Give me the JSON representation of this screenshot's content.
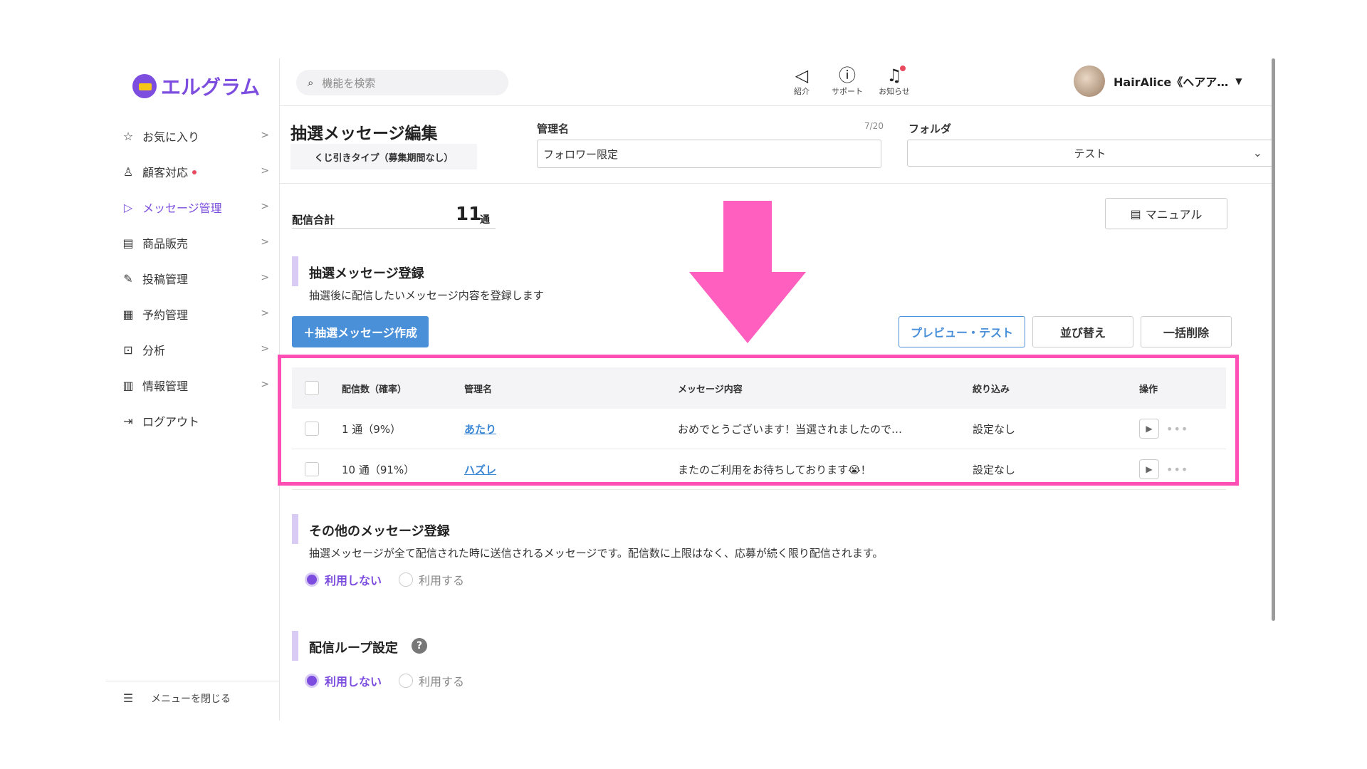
{
  "app": {
    "name": "エルグラム"
  },
  "sidebar": {
    "items": [
      {
        "label": "お気に入り",
        "icon": "star-icon",
        "glyph": "☆"
      },
      {
        "label": "顧客対応",
        "icon": "person-icon",
        "glyph": "♙"
      },
      {
        "label": "メッセージ管理",
        "icon": "send-icon",
        "glyph": "▷"
      },
      {
        "label": "商品販売",
        "icon": "store-icon",
        "glyph": "▤"
      },
      {
        "label": "投稿管理",
        "icon": "edit-icon",
        "glyph": "✎"
      },
      {
        "label": "予約管理",
        "icon": "calendar-icon",
        "glyph": "▦"
      },
      {
        "label": "分析",
        "icon": "analysis-icon",
        "glyph": "⊡"
      },
      {
        "label": "情報管理",
        "icon": "chart-icon",
        "glyph": "▥"
      },
      {
        "label": "ログアウト",
        "icon": "logout-icon",
        "glyph": "⇥"
      }
    ],
    "close_menu": "メニューを閉じる",
    "accent": "#7c4dde"
  },
  "header": {
    "search_placeholder": "機能を検索",
    "intro": "紹介",
    "support": "サポート",
    "notifications": "お知らせ",
    "user_name": "HairAlice《ヘアア…"
  },
  "page": {
    "title": "抽選メッセージ編集",
    "type_badge": "くじ引きタイプ（募集期間なし）",
    "name_label": "管理名",
    "name_counter": "7/20",
    "name_value": "フォロワー限定",
    "folder_label": "フォルダ",
    "folder_value": "テスト",
    "total_label": "配信合計",
    "total_value": "11",
    "total_unit": "通",
    "manual_button": "マニュアル"
  },
  "lottery_section": {
    "title": "抽選メッセージ登録",
    "desc": "抽選後に配信したいメッセージ内容を登録します",
    "create_button": "＋抽選メッセージ作成",
    "preview_button": "プレビュー・テスト",
    "sort_button": "並び替え",
    "bulk_delete_button": "一括削除",
    "columns": [
      "配信数（確率）",
      "管理名",
      "メッセージ内容",
      "絞り込み",
      "操作"
    ],
    "rows": [
      {
        "count": "1 通（9%）",
        "name": "あたり",
        "message": "おめでとうございます！当選されましたので…",
        "filter": "設定なし"
      },
      {
        "count": "10 通（91%）",
        "name": "ハズレ",
        "message": "またのご利用をお待ちしております😭！",
        "filter": "設定なし"
      }
    ],
    "highlight_color": "#ff4fb5"
  },
  "other_section": {
    "title": "その他のメッセージ登録",
    "desc": "抽選メッセージが全て配信された時に送信されるメッセージです。配信数に上限はなく、応募が続く限り配信されます。",
    "option_off": "利用しない",
    "option_on": "利用する"
  },
  "loop_section": {
    "title": "配信ループ設定",
    "help": "?",
    "option_off": "利用しない",
    "option_on": "利用する"
  }
}
